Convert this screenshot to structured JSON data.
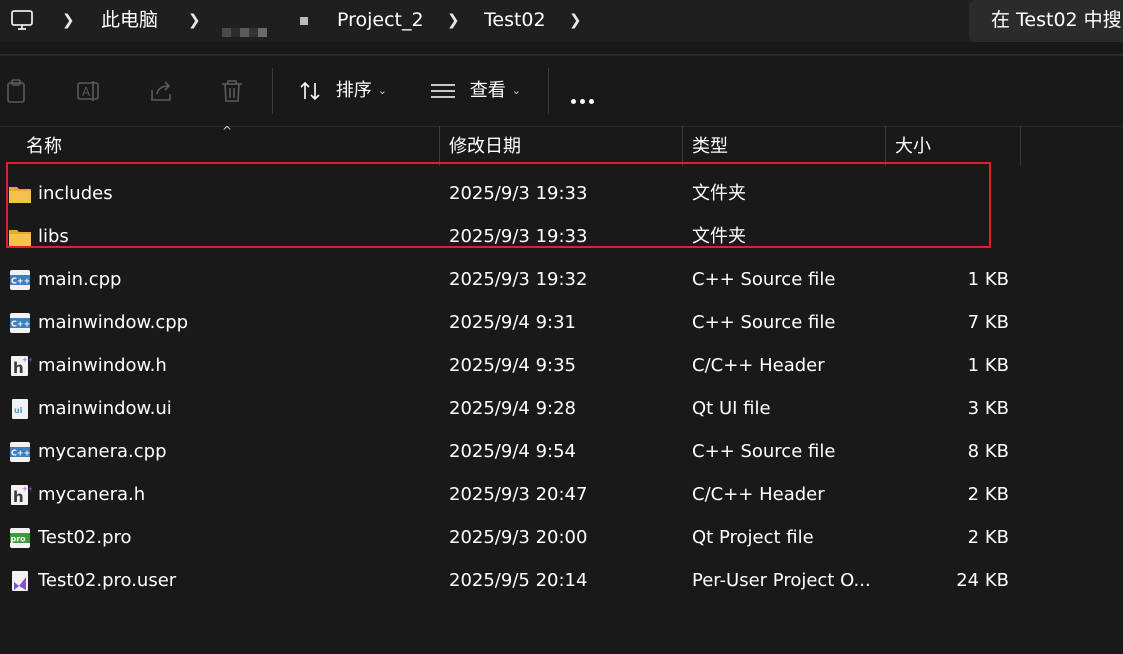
{
  "address_bar": {
    "crumbs": [
      "此电脑",
      "Project_2",
      "Test02"
    ],
    "search_placeholder": "在 Test02 中搜"
  },
  "toolbar": {
    "sort_label": "排序",
    "view_label": "查看"
  },
  "columns": {
    "name": "名称",
    "date": "修改日期",
    "type": "类型",
    "size": "大小"
  },
  "files": [
    {
      "name": "includes",
      "date": "2025/9/3 19:33",
      "type": "文件夹",
      "size": "",
      "icon": "folder-icon"
    },
    {
      "name": "libs",
      "date": "2025/9/3 19:33",
      "type": "文件夹",
      "size": "",
      "icon": "folder-icon"
    },
    {
      "name": "main.cpp",
      "date": "2025/9/3 19:32",
      "type": "C++ Source file",
      "size": "1 KB",
      "icon": "cpp-file-icon"
    },
    {
      "name": "mainwindow.cpp",
      "date": "2025/9/4 9:31",
      "type": "C++ Source file",
      "size": "7 KB",
      "icon": "cpp-file-icon"
    },
    {
      "name": "mainwindow.h",
      "date": "2025/9/4 9:35",
      "type": "C/C++ Header",
      "size": "1 KB",
      "icon": "header-file-icon"
    },
    {
      "name": "mainwindow.ui",
      "date": "2025/9/4 9:28",
      "type": "Qt UI file",
      "size": "3 KB",
      "icon": "ui-file-icon"
    },
    {
      "name": "mycanera.cpp",
      "date": "2025/9/4 9:54",
      "type": "C++ Source file",
      "size": "8 KB",
      "icon": "cpp-file-icon"
    },
    {
      "name": "mycanera.h",
      "date": "2025/9/3 20:47",
      "type": "C/C++ Header",
      "size": "2 KB",
      "icon": "header-file-icon"
    },
    {
      "name": "Test02.pro",
      "date": "2025/9/3 20:00",
      "type": "Qt Project file",
      "size": "2 KB",
      "icon": "pro-file-icon"
    },
    {
      "name": "Test02.pro.user",
      "date": "2025/9/5 20:14",
      "type": "Per-User Project O...",
      "size": "24 KB",
      "icon": "user-file-icon"
    }
  ],
  "colors": {
    "background": "#191919",
    "highlight_border": "#e0202a",
    "folder": "#f4c24d"
  }
}
